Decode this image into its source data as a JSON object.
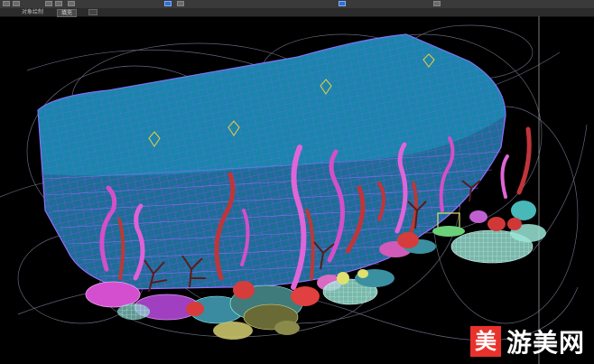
{
  "toolbar": {
    "icons": [
      "select-icon",
      "move-icon",
      "rotate-icon",
      "scale-icon",
      "snap-icon",
      "mirror-icon",
      "align-icon",
      "layer-icon",
      "render-icon"
    ]
  },
  "subbar": {
    "left_label": "对象绘制",
    "tab_label": "填充"
  },
  "watermark": {
    "badge": "美",
    "text": "游美网"
  }
}
